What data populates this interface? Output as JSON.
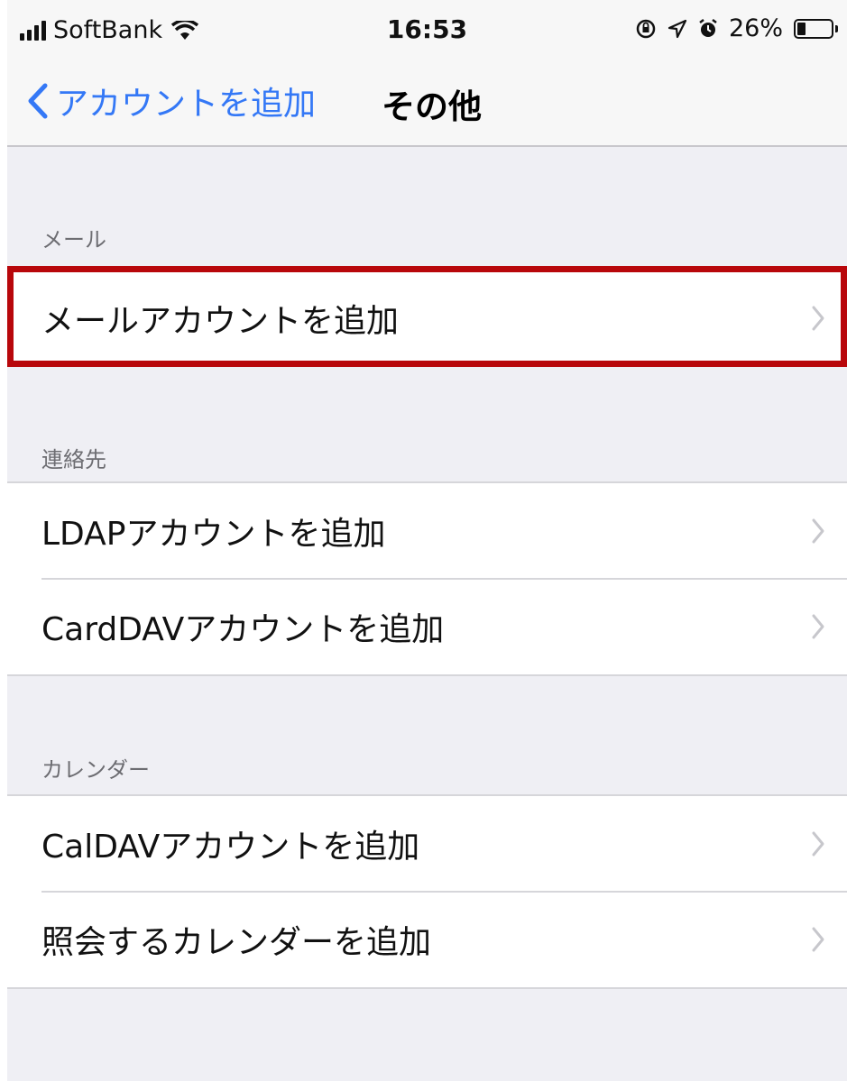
{
  "status_bar": {
    "carrier": "SoftBank",
    "time": "16:53",
    "battery_percent": "26%",
    "battery_level": 0.26,
    "icons": [
      "signal-icon",
      "wifi-icon",
      "orientation-lock-icon",
      "location-icon",
      "alarm-icon",
      "battery-icon"
    ]
  },
  "nav": {
    "back_label": "アカウントを追加",
    "title": "その他"
  },
  "sections": {
    "mail": {
      "header": "メール",
      "items": [
        {
          "label": "メールアカウントを追加"
        }
      ]
    },
    "contacts": {
      "header": "連絡先",
      "items": [
        {
          "label": "LDAPアカウントを追加"
        },
        {
          "label": "CardDAVアカウントを追加"
        }
      ]
    },
    "calendar": {
      "header": "カレンダー",
      "items": [
        {
          "label": "CalDAVアカウントを追加"
        },
        {
          "label": "照会するカレンダーを追加"
        }
      ]
    }
  },
  "colors": {
    "accent": "#3478f6",
    "highlight_border": "#b8070b",
    "background": "#efeff4"
  }
}
